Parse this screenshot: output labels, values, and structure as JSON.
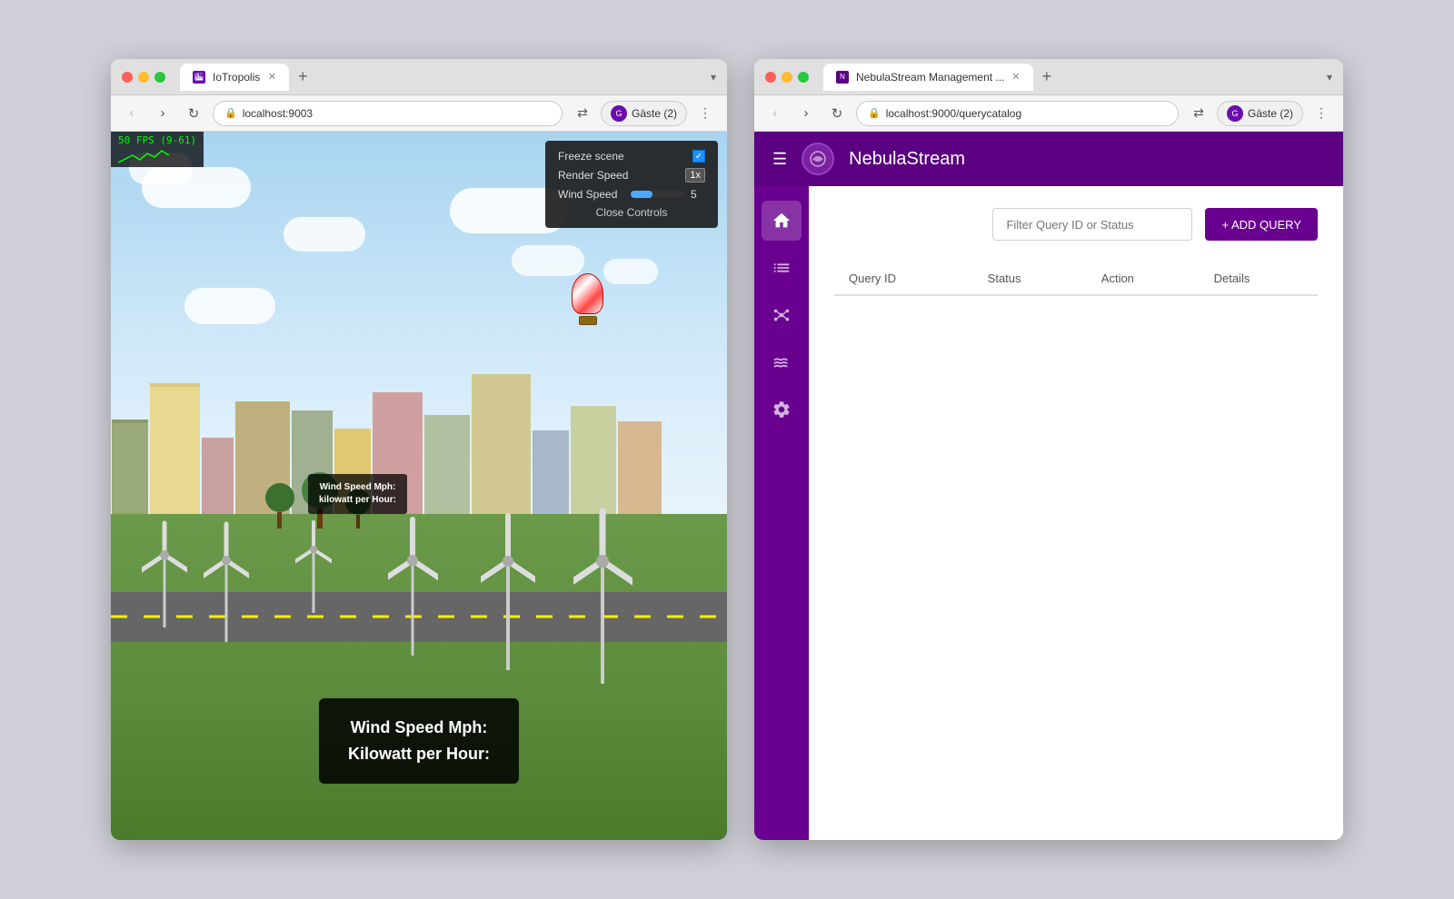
{
  "left_browser": {
    "tab_title": "IoTropolis",
    "tab_new": "+",
    "url": "localhost:9003",
    "profile_label": "Gäste (2)",
    "fps": "50 FPS (9-61)",
    "controls": {
      "freeze_scene_label": "Freeze scene",
      "freeze_checked": true,
      "render_speed_label": "Render Speed",
      "render_speed_value": "1x",
      "wind_speed_label": "Wind Speed",
      "wind_speed_value": "5",
      "close_label": "Close Controls"
    },
    "sign": {
      "line1": "Wind Speed Mph:",
      "line2": "Kilowatt per Hour:"
    }
  },
  "right_browser": {
    "tab_title": "NebulaStream Management ...",
    "tab_new": "+",
    "url": "localhost:9000/querycatalog",
    "profile_label": "Gäste (2)",
    "app": {
      "header_title": "NebulaStream",
      "filter_placeholder": "Filter Query ID or Status",
      "add_query_label": "+ ADD QUERY",
      "table": {
        "columns": [
          "Query ID",
          "Status",
          "Action",
          "Details"
        ]
      },
      "sidebar_icons": [
        "home",
        "list",
        "nodes",
        "waves",
        "settings"
      ]
    }
  }
}
